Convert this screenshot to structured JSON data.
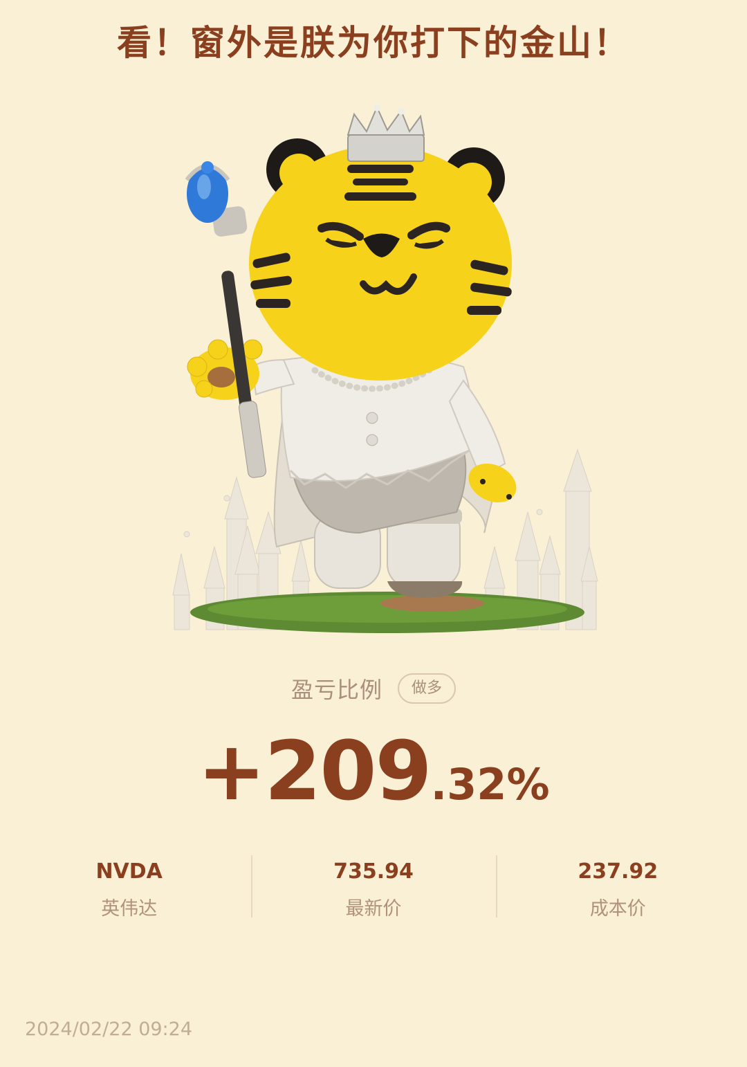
{
  "headline": "看！窗外是朕为你打下的金山！",
  "illustration": {
    "subject": "tiger-king-mascot-icon",
    "colors": {
      "background": "#FAF0D6",
      "tiger_yellow": "#F6D21A",
      "stripe": "#2C2420",
      "outfit": "#E9E4DA",
      "grass": "#4F7A2E",
      "scepter_gem": "#2F79D8"
    }
  },
  "ratio": {
    "label": "盈亏比例",
    "direction_badge": "做多",
    "value_main": "+209",
    "value_decimal": ".32%"
  },
  "stats": [
    {
      "value": "NVDA",
      "label": "英伟达"
    },
    {
      "value": "735.94",
      "label": "最新价"
    },
    {
      "value": "237.92",
      "label": "成本价"
    }
  ],
  "timestamp": "2024/02/22 09:24",
  "colors": {
    "accent": "#8A3F1E",
    "muted": "#A98F7C",
    "background": "#FAF0D6"
  }
}
